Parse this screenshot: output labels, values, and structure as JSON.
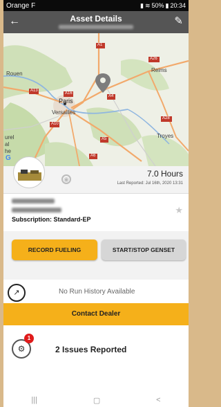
{
  "status_bar": {
    "carrier": "Orange F",
    "battery": "50%",
    "time": "20:34"
  },
  "header": {
    "back_icon": "arrow-left-icon",
    "title": "Asset Details",
    "edit_icon": "pencil-icon"
  },
  "map": {
    "labels": [
      "Rouen",
      "Reims",
      "Paris",
      "Versailles",
      "Troyes",
      "A1",
      "A26",
      "A13",
      "A16",
      "A4",
      "A10",
      "A5",
      "A28",
      "A6"
    ],
    "pin_icon": "map-pin-icon",
    "partial_labels": [
      "urel",
      "al",
      "he"
    ]
  },
  "asset_summary": {
    "hours": "7.0 Hours",
    "last_reported": "Last Reported: Jul 16th, 2020 13:31"
  },
  "asset_details": {
    "subscription": "Subscription: Standard-EP"
  },
  "actions": {
    "record_fueling": "RECORD FUELING",
    "start_stop": "START/STOP GENSET"
  },
  "run_history": {
    "text": "No Run History Available"
  },
  "dealer": {
    "label": "Contact Dealer"
  },
  "issues": {
    "badge": "1",
    "text": "2 Issues Reported"
  },
  "nav": {
    "recent": "|||",
    "home": "▢",
    "back": "<"
  },
  "colors": {
    "accent": "#f5b01a",
    "header": "#555555",
    "badge": "#e01b1b"
  }
}
